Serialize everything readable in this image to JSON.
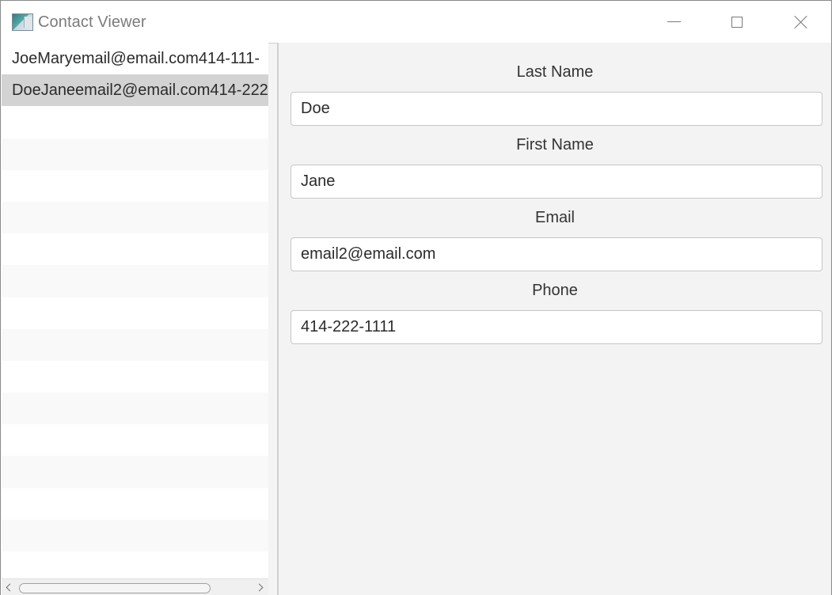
{
  "window": {
    "title": "Contact Viewer",
    "controls": {
      "minimize": "minimize-icon",
      "maximize": "maximize-icon",
      "close": "close-icon"
    }
  },
  "contacts": {
    "items": [
      {
        "label": "JoeMaryemail@email.com414-111-",
        "selected": false
      },
      {
        "label": "DoeJaneemail2@email.com414-222",
        "selected": true
      }
    ],
    "empty_rows": 15
  },
  "form": {
    "last_name": {
      "label": "Last Name",
      "value": "Doe"
    },
    "first_name": {
      "label": "First Name",
      "value": "Jane"
    },
    "email": {
      "label": "Email",
      "value": "email2@email.com"
    },
    "phone": {
      "label": "Phone",
      "value": "414-222-1111"
    }
  },
  "colors": {
    "selection": "#d3d3d3",
    "form_background": "#f3f3f3",
    "title_text": "#7b7b7b"
  }
}
